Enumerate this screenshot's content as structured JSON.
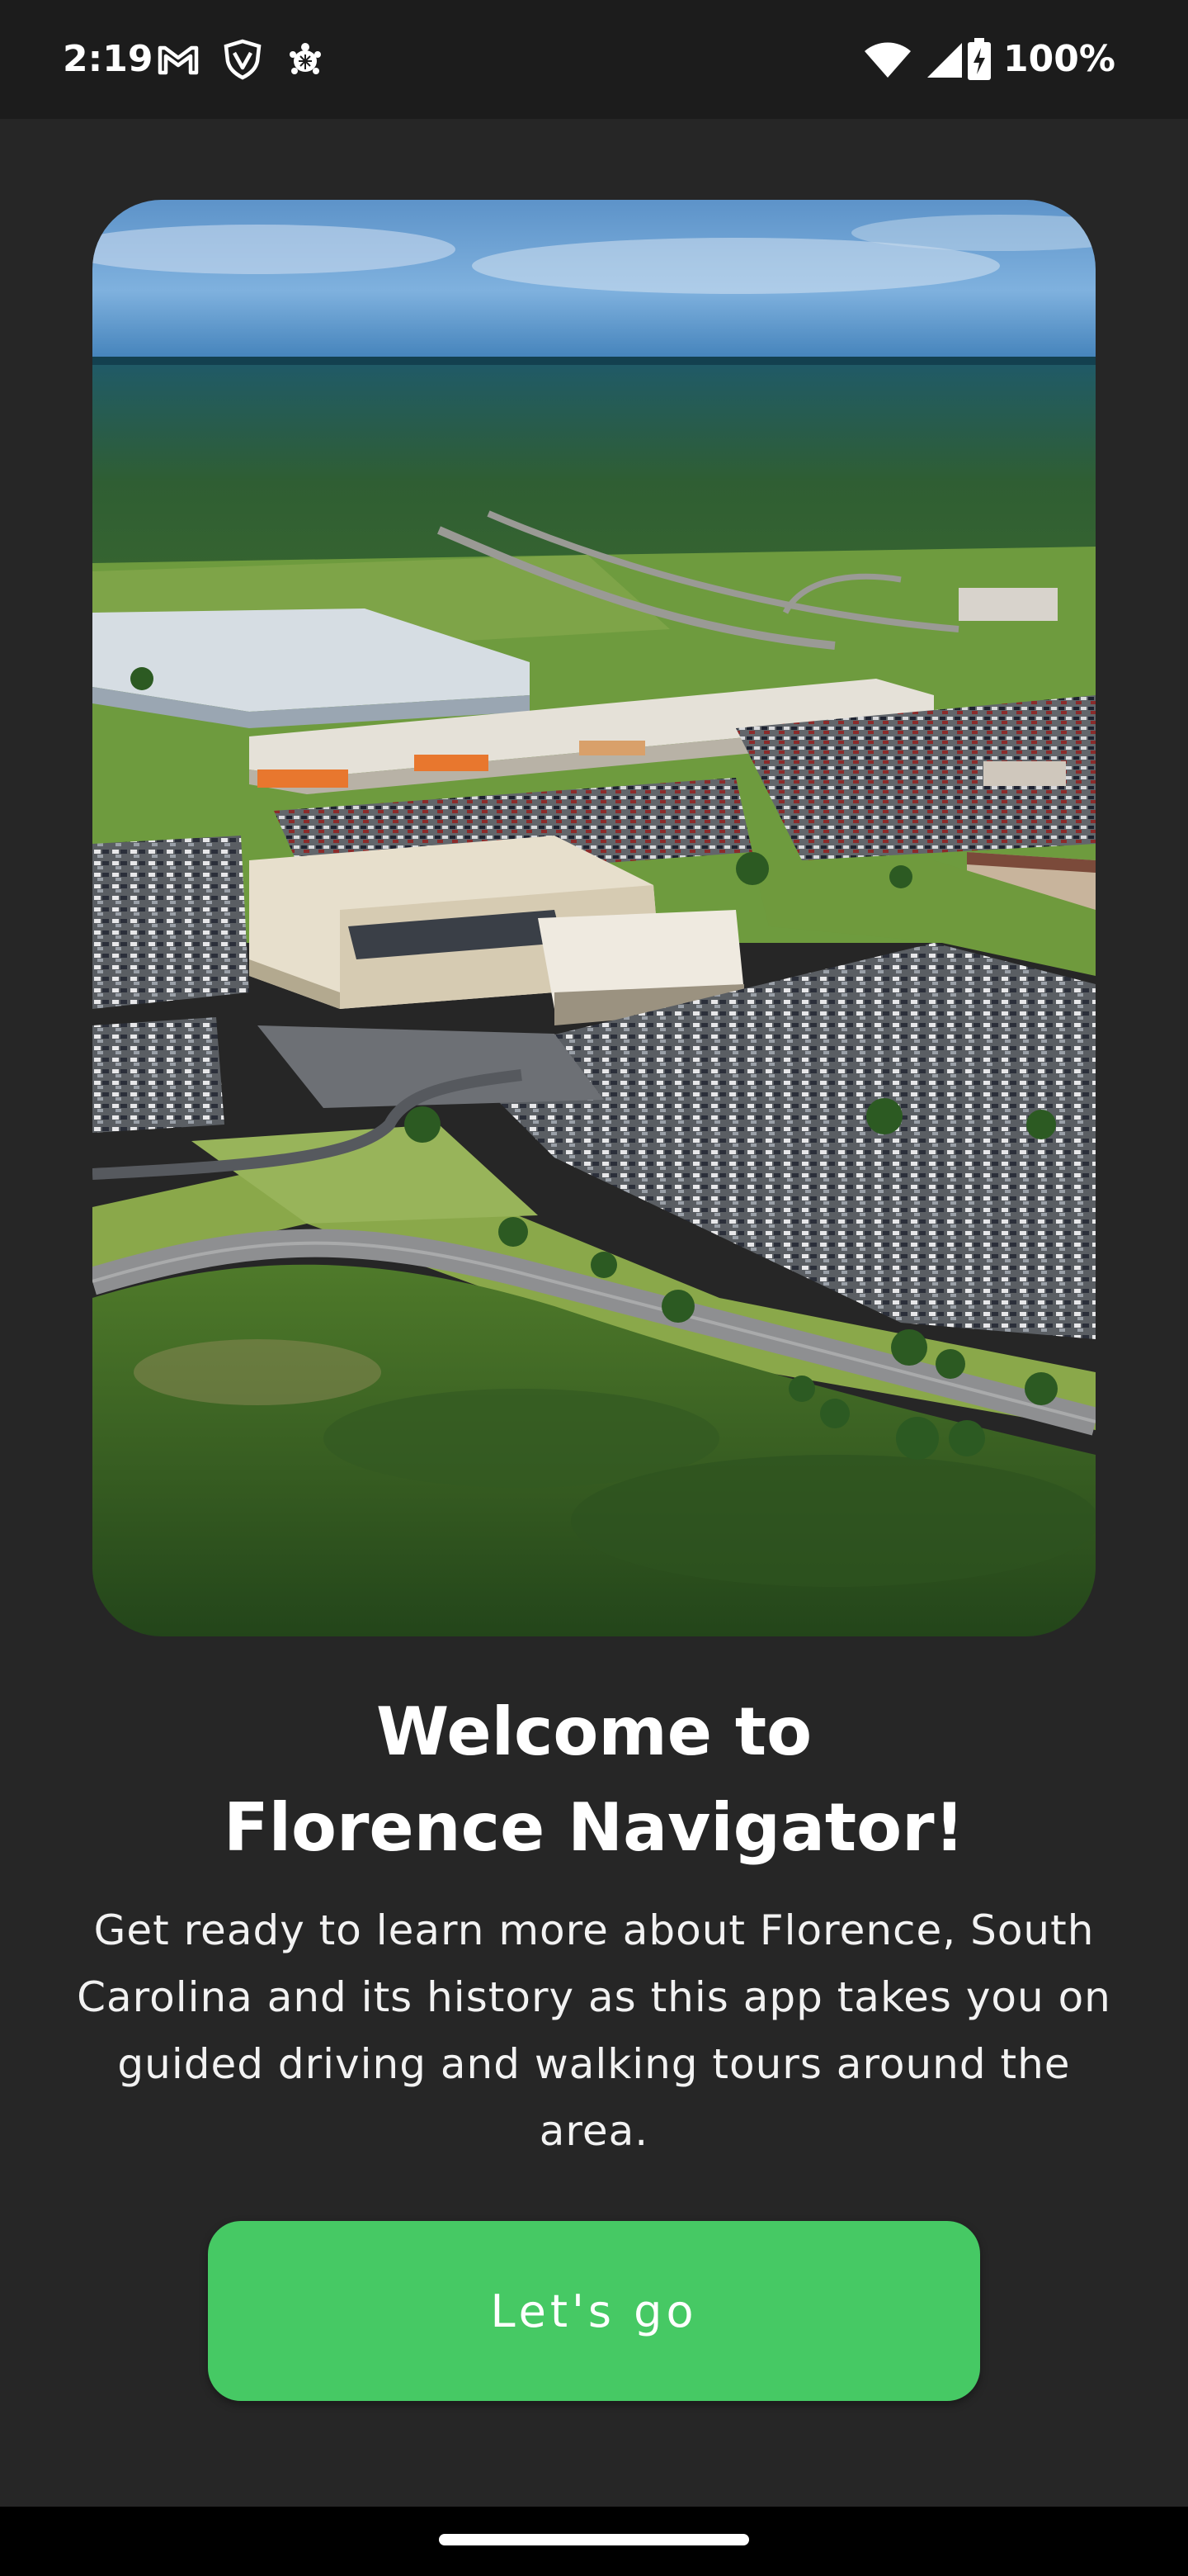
{
  "status_bar": {
    "time": "2:19",
    "battery": "100%",
    "icons": [
      "gmail-icon",
      "vpn-shield-icon",
      "turtle-app-icon",
      "wifi-icon",
      "cellular-signal-icon",
      "battery-charging-icon"
    ]
  },
  "hero": {
    "image": "aerial-view-florence-icon"
  },
  "welcome": {
    "title_line1": "Welcome to",
    "title_line2": "Florence Navigator!",
    "description": "Get ready to learn more about Florence, South Carolina and its history as this app takes you on guided driving and walking tours around the area."
  },
  "cta": {
    "label": "Let's go"
  },
  "colors": {
    "background": "#262626",
    "status_bar": "#1c1c1c",
    "accent": "#46c964"
  }
}
